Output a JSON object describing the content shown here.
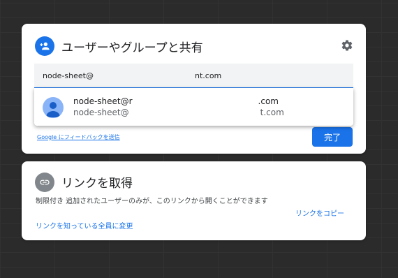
{
  "share_dialog": {
    "title": "ユーザーやグループと共有",
    "icon": "person-add-icon",
    "settings_icon": "gear-icon",
    "input": {
      "value_prefix": "node-sheet@",
      "value_suffix": "nt.com"
    },
    "suggestion": {
      "name_prefix": "node-sheet@r",
      "name_suffix": ".com",
      "email_prefix": "node-sheet@",
      "email_suffix": "t.com"
    },
    "feedback_link": "Google にフィードバックを送信",
    "done_button": "完了",
    "colors": {
      "accent": "#1a73e8",
      "header_icon_bg": "#1a73e8"
    }
  },
  "link_dialog": {
    "title": "リンクを取得",
    "icon": "link-icon",
    "description": "制限付き 追加されたユーザーのみが、このリンクから開くことができます",
    "change_link": "リンクを知っている全員に変更",
    "copy_link": "リンクをコピー",
    "colors": {
      "icon_bg": "#80868b"
    }
  }
}
